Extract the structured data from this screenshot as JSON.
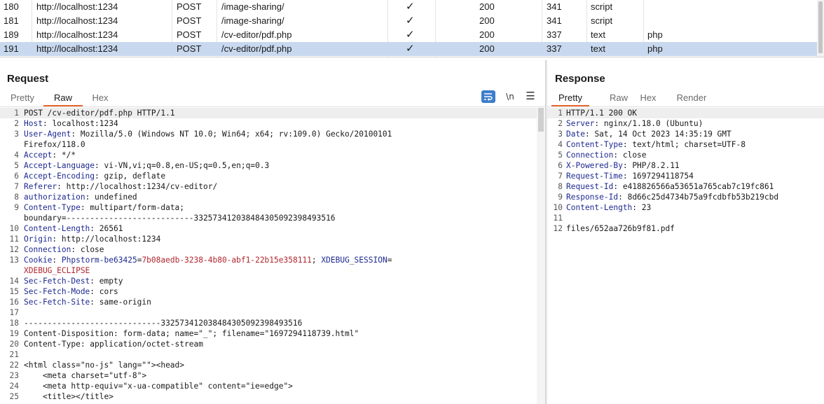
{
  "history": {
    "rows": [
      {
        "num": "180",
        "host": "http://localhost:1234",
        "method": "POST",
        "url": "/image-sharing/",
        "params": "✓",
        "status": "200",
        "length": "341",
        "mime": "script",
        "ext": "",
        "selected": false
      },
      {
        "num": "181",
        "host": "http://localhost:1234",
        "method": "POST",
        "url": "/image-sharing/",
        "params": "✓",
        "status": "200",
        "length": "341",
        "mime": "script",
        "ext": "",
        "selected": false
      },
      {
        "num": "189",
        "host": "http://localhost:1234",
        "method": "POST",
        "url": "/cv-editor/pdf.php",
        "params": "✓",
        "status": "200",
        "length": "337",
        "mime": "text",
        "ext": "php",
        "selected": false
      },
      {
        "num": "191",
        "host": "http://localhost:1234",
        "method": "POST",
        "url": "/cv-editor/pdf.php",
        "params": "✓",
        "status": "200",
        "length": "337",
        "mime": "text",
        "ext": "php",
        "selected": true
      }
    ]
  },
  "request": {
    "title": "Request",
    "tabs": [
      {
        "label": "Pretty",
        "active": false
      },
      {
        "label": "Raw",
        "active": true
      },
      {
        "label": "Hex",
        "active": false
      }
    ],
    "newline_label": "\\n",
    "menu_label": "☰",
    "lines": [
      {
        "n": "1",
        "t": "POST /cv-editor/pdf.php HTTP/1.1"
      },
      {
        "n": "2",
        "k": "Host",
        "v": "localhost:1234"
      },
      {
        "n": "3",
        "k": "User-Agent",
        "v": "Mozilla/5.0 (Windows NT 10.0; Win64; x64; rv:109.0) Gecko/20100101"
      },
      {
        "n": "",
        "t": "Firefox/118.0"
      },
      {
        "n": "4",
        "k": "Accept",
        "v": "*/*"
      },
      {
        "n": "5",
        "k": "Accept-Language",
        "v": "vi-VN,vi;q=0.8,en-US;q=0.5,en;q=0.3"
      },
      {
        "n": "6",
        "k": "Accept-Encoding",
        "v": "gzip, deflate"
      },
      {
        "n": "7",
        "k": "Referer",
        "v": "http://localhost:1234/cv-editor/"
      },
      {
        "n": "8",
        "k": "authorization",
        "v": "undefined"
      },
      {
        "n": "9",
        "k": "Content-Type",
        "v": "multipart/form-data;"
      },
      {
        "n": "",
        "t": "boundary=---------------------------332573412038484305092398493516"
      },
      {
        "n": "10",
        "k": "Content-Length",
        "v": "26561"
      },
      {
        "n": "11",
        "k": "Origin",
        "v": "http://localhost:1234"
      },
      {
        "n": "12",
        "k": "Connection",
        "v": "close"
      },
      {
        "n": "13",
        "k": "Cookie",
        "cookie": [
          {
            "name": "Phpstorm-be63425",
            "value": "7b08aedb-3238-4b80-abf1-22b15e358111"
          },
          {
            "name": "XDEBUG_SESSION",
            "value": ""
          }
        ]
      },
      {
        "n": "",
        "cv": "XDEBUG_ECLIPSE"
      },
      {
        "n": "14",
        "k": "Sec-Fetch-Dest",
        "v": "empty"
      },
      {
        "n": "15",
        "k": "Sec-Fetch-Mode",
        "v": "cors"
      },
      {
        "n": "16",
        "k": "Sec-Fetch-Site",
        "v": "same-origin"
      },
      {
        "n": "17",
        "t": ""
      },
      {
        "n": "18",
        "t": "-----------------------------332573412038484305092398493516"
      },
      {
        "n": "19",
        "t": "Content-Disposition: form-data; name=\"_\"; filename=\"1697294118739.html\""
      },
      {
        "n": "20",
        "t": "Content-Type: application/octet-stream"
      },
      {
        "n": "21",
        "t": ""
      },
      {
        "n": "22",
        "t": "<html class=\"no-js\" lang=\"\"><head>"
      },
      {
        "n": "23",
        "t": "    <meta charset=\"utf-8\">"
      },
      {
        "n": "24",
        "t": "    <meta http-equiv=\"x-ua-compatible\" content=\"ie=edge\">"
      },
      {
        "n": "25",
        "t": "    <title></title>"
      }
    ]
  },
  "response": {
    "title": "Response",
    "tabs": [
      {
        "label": "Pretty",
        "active": true
      },
      {
        "label": "Raw",
        "active": false
      },
      {
        "label": "Hex",
        "active": false
      },
      {
        "label": "Render",
        "active": false
      }
    ],
    "lines": [
      {
        "n": "1",
        "t": "HTTP/1.1 200 OK"
      },
      {
        "n": "2",
        "k": "Server",
        "v": "nginx/1.18.0 (Ubuntu)"
      },
      {
        "n": "3",
        "k": "Date",
        "v": "Sat, 14 Oct 2023 14:35:19 GMT"
      },
      {
        "n": "4",
        "k": "Content-Type",
        "v": "text/html; charset=UTF-8"
      },
      {
        "n": "5",
        "k": "Connection",
        "v": "close"
      },
      {
        "n": "6",
        "k": "X-Powered-By",
        "v": "PHP/8.2.11"
      },
      {
        "n": "7",
        "k": "Request-Time",
        "v": "1697294118754"
      },
      {
        "n": "8",
        "k": "Request-Id",
        "v": "e418826566a53651a765cab7c19fc861"
      },
      {
        "n": "9",
        "k": "Response-Id",
        "v": "8d66c25d4734b75a9fcdbfb53b219cbd"
      },
      {
        "n": "10",
        "k": "Content-Length",
        "v": "23"
      },
      {
        "n": "11",
        "t": ""
      },
      {
        "n": "12",
        "t": "files/652aa726b9f81.pdf"
      }
    ]
  },
  "colors": {
    "accent_tab": "#e8682e",
    "selected_row": "#c8d8ee",
    "header_key": "#1e2a90",
    "cookie_value": "#b0262e",
    "wrap_button": "#3d7dcc"
  },
  "icons": {
    "wrap": "wrap-lines-icon",
    "newline": "show-newlines-icon",
    "menu": "menu-icon"
  }
}
